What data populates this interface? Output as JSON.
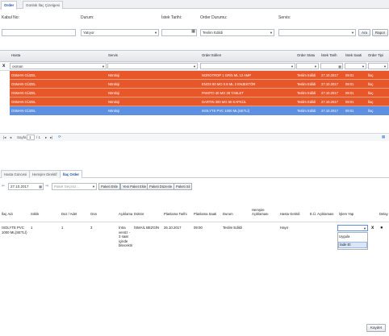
{
  "tabs": [
    {
      "label": "Order"
    },
    {
      "label": "Günlük İlaç Çizelgesi"
    }
  ],
  "filters": {
    "kabul_no_label": "Kabul No:",
    "durum_label": "Durum:",
    "durum_value": "Yatıyor",
    "istek_tarihi_label": "İstek Tarihi:",
    "order_durumu_label": "Order Durumu:",
    "order_durumu_value": "Teslim Edildi",
    "servis_label": "Servis:",
    "ara_button": "Ara",
    "rapor_button": "Rapor"
  },
  "grid": {
    "columns": [
      "Hasta",
      "Servis",
      "Order Edilen",
      "Order Statu",
      "İstek Tarih",
      "İstek Saati",
      "Order Tipi"
    ],
    "filter_hasta": "osman",
    "rows": [
      {
        "hasta": "OSMAN GÜZEL",
        "servis": "Nöroloji",
        "order": "NOROTROP 1 GR/5 ML 12 AMP",
        "statu": "Teslim Edildi",
        "tarih": "27.10.2017",
        "saat": "09:01",
        "tip": "İlaç",
        "selected": false
      },
      {
        "hasta": "OSMAN GÜZEL",
        "servis": "Nöroloji",
        "order": "ENOX 80 MG 0.8 ML 2 ENJEKTÖR",
        "statu": "Teslim Edildi",
        "tarih": "27.10.2017",
        "saat": "09:01",
        "tip": "İlaç",
        "selected": false
      },
      {
        "hasta": "OSMAN GÜZEL",
        "servis": "Nöroloji",
        "order": "PAMITO 40 MG 28 TABLET",
        "statu": "Teslim Edildi",
        "tarih": "27.10.2017",
        "saat": "09:01",
        "tip": "İlaç",
        "selected": false
      },
      {
        "hasta": "OSMAN GÜZEL",
        "servis": "Nöroloji",
        "order": "DARTIN 300 MG 50 KAPSÜL",
        "statu": "Teslim Edildi",
        "tarih": "27.10.2017",
        "saat": "09:01",
        "tip": "İlaç",
        "selected": false
      },
      {
        "hasta": "OSMAN GÜZEL",
        "servis": "Nöroloji",
        "order": "ISOLYTE PVC 1000 ML(SETLİ)",
        "statu": "Teslim Edildi",
        "tarih": "27.10.2017",
        "saat": "09:01",
        "tip": "İlaç",
        "selected": true
      }
    ],
    "colors": {
      "row": "#e8572a",
      "selected": "#5d8fe3"
    }
  },
  "pager": {
    "sayfa_label": "Sayfa",
    "page": "1",
    "of": "/ 1"
  },
  "subtabs": [
    {
      "label": "Hasta Güncesi"
    },
    {
      "label": "Hemşire Direktif"
    },
    {
      "label": "İlaç Order"
    }
  ],
  "toolbar": {
    "date": "27.10.2017",
    "paket_placeholder": "Paket Seçiniz...",
    "paket_ekle": "Paketi Ekle",
    "yeni_paket": "Yeni Paket Ekle",
    "paket_duzenle": "Paketi Düzenle",
    "paket_sil": "Paketi Sil"
  },
  "detail": {
    "headers": [
      "İlaç Adı",
      "Sıklık",
      "Doz / Adet",
      "Gün",
      "Açıklama",
      "Doktor",
      "Planlama Tarihi",
      "Planlama Saati",
      "Durum",
      "Hemşire Açıklaması",
      "Hasta Getirdi",
      "E.Ü. Açıklaması",
      "İşlem Yap",
      "Delay"
    ],
    "row": {
      "ilac": "ISOLYTE PVC 1000 ML(SETLİ)",
      "siklik": "1",
      "doz": "1",
      "gun": "3",
      "aciklama": "İntra venöz - 3 saat içinde bitecektir",
      "doktor": "İSMAİL BEZGİN",
      "plan_tarih": "26.10.2017",
      "plan_saat": "09:00",
      "durum": "Teslim Edildi",
      "hasta_getirdi": "Hayır"
    },
    "dropdown_options": [
      "Uygula",
      "İade Et"
    ]
  },
  "footer": {
    "kaydet": "Kaydet"
  }
}
